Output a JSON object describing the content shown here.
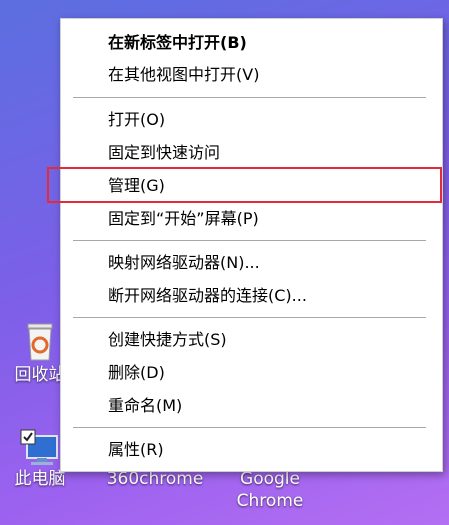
{
  "desktop": {
    "recycle_bin_label": "回收站",
    "this_pc_label": "此电脑",
    "app1_label": "360chrome",
    "app2_label_line1": "Google",
    "app2_label_line2": "Chrome"
  },
  "context_menu": {
    "open_new_tab": "在新标签中打开(B)",
    "open_other_view": "在其他视图中打开(V)",
    "open": "打开(O)",
    "pin_quick_access": "固定到快速访问",
    "manage": "管理(G)",
    "pin_start": "固定到“开始”屏幕(P)",
    "map_drive": "映射网络驱动器(N)...",
    "disconnect_drive": "断开网络驱动器的连接(C)...",
    "create_shortcut": "创建快捷方式(S)",
    "delete": "删除(D)",
    "rename": "重命名(M)",
    "properties": "属性(R)"
  },
  "colors": {
    "highlight_border": "#e32b3a",
    "menu_bg": "#ffffff"
  }
}
